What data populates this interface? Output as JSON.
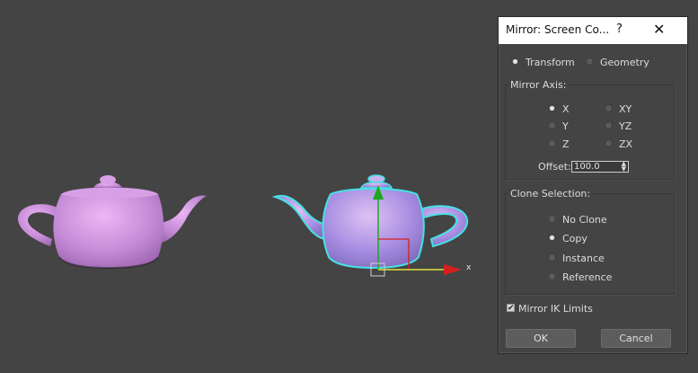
{
  "dialog": {
    "title": "Mirror: Screen Co...",
    "help_label": "?",
    "close_label": "✕",
    "mode": {
      "transform_label": "Transform",
      "geometry_label": "Geometry",
      "selected": "transform"
    },
    "mirror_axis": {
      "label": "Mirror Axis:",
      "options": [
        "X",
        "Y",
        "Z",
        "XY",
        "YZ",
        "ZX"
      ],
      "selected": "X",
      "offset_label": "Offset:",
      "offset_value": "100.0"
    },
    "clone_selection": {
      "label": "Clone Selection:",
      "options": [
        "No Clone",
        "Copy",
        "Instance",
        "Reference"
      ],
      "selected": "Copy"
    },
    "mirror_ik_label": "Mirror IK Limits",
    "mirror_ik_checked": true,
    "ok_label": "OK",
    "cancel_label": "Cancel"
  },
  "viewport": {
    "axis_label": "x",
    "colors": {
      "teapot": "#c790e0",
      "selection": "#47e0e6",
      "y_axis": "#1ea81e",
      "x_axis": "#d81f1f"
    }
  }
}
